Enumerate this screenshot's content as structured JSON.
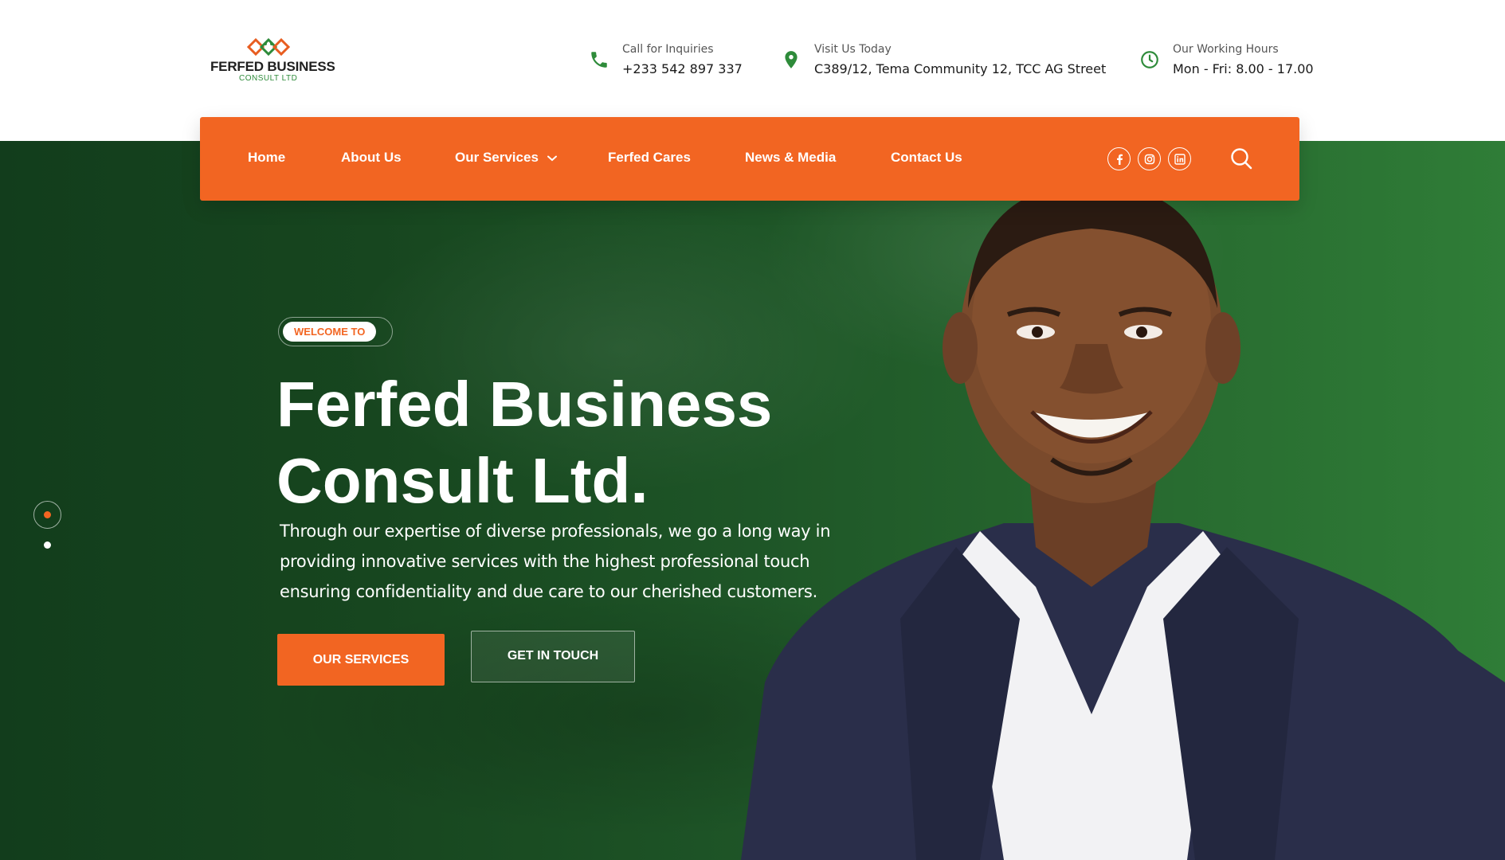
{
  "brand": {
    "name": "FERFED BUSINESS",
    "tagline": "CONSULT LTD",
    "colors": {
      "primary": "#f26522",
      "green": "#1e5527",
      "green_light": "#2e8b3a"
    }
  },
  "header": {
    "phone": {
      "icon": "phone-icon",
      "label": "Call for Inquiries",
      "value": "+233 542 897 337"
    },
    "visit": {
      "icon": "map-pin-icon",
      "label": "Visit Us Today",
      "value": "C389/12, Tema Community 12, TCC AG Street"
    },
    "hours": {
      "icon": "clock-icon",
      "label": "Our Working Hours",
      "value": "Mon - Fri: 8.00 - 17.00"
    }
  },
  "nav": {
    "home": "Home",
    "about": "About Us",
    "services": "Our Services",
    "cares": "Ferfed Cares",
    "news": "News & Media",
    "contact": "Contact Us",
    "social": [
      "facebook-icon",
      "instagram-icon",
      "linkedin-icon"
    ],
    "search_icon": "search-icon"
  },
  "hero": {
    "badge": "WELCOME TO",
    "title_line1": "Ferfed Business",
    "title_line2": "Consult Ltd.",
    "description": "Through our expertise of diverse professionals, we go a long way in providing innovative services with the highest professional touch ensuring confidentiality and due care to our cherished customers.",
    "primary_button": "OUR SERVICES",
    "secondary_button": "GET IN TOUCH"
  },
  "slider": {
    "current": 1,
    "total": 2
  }
}
